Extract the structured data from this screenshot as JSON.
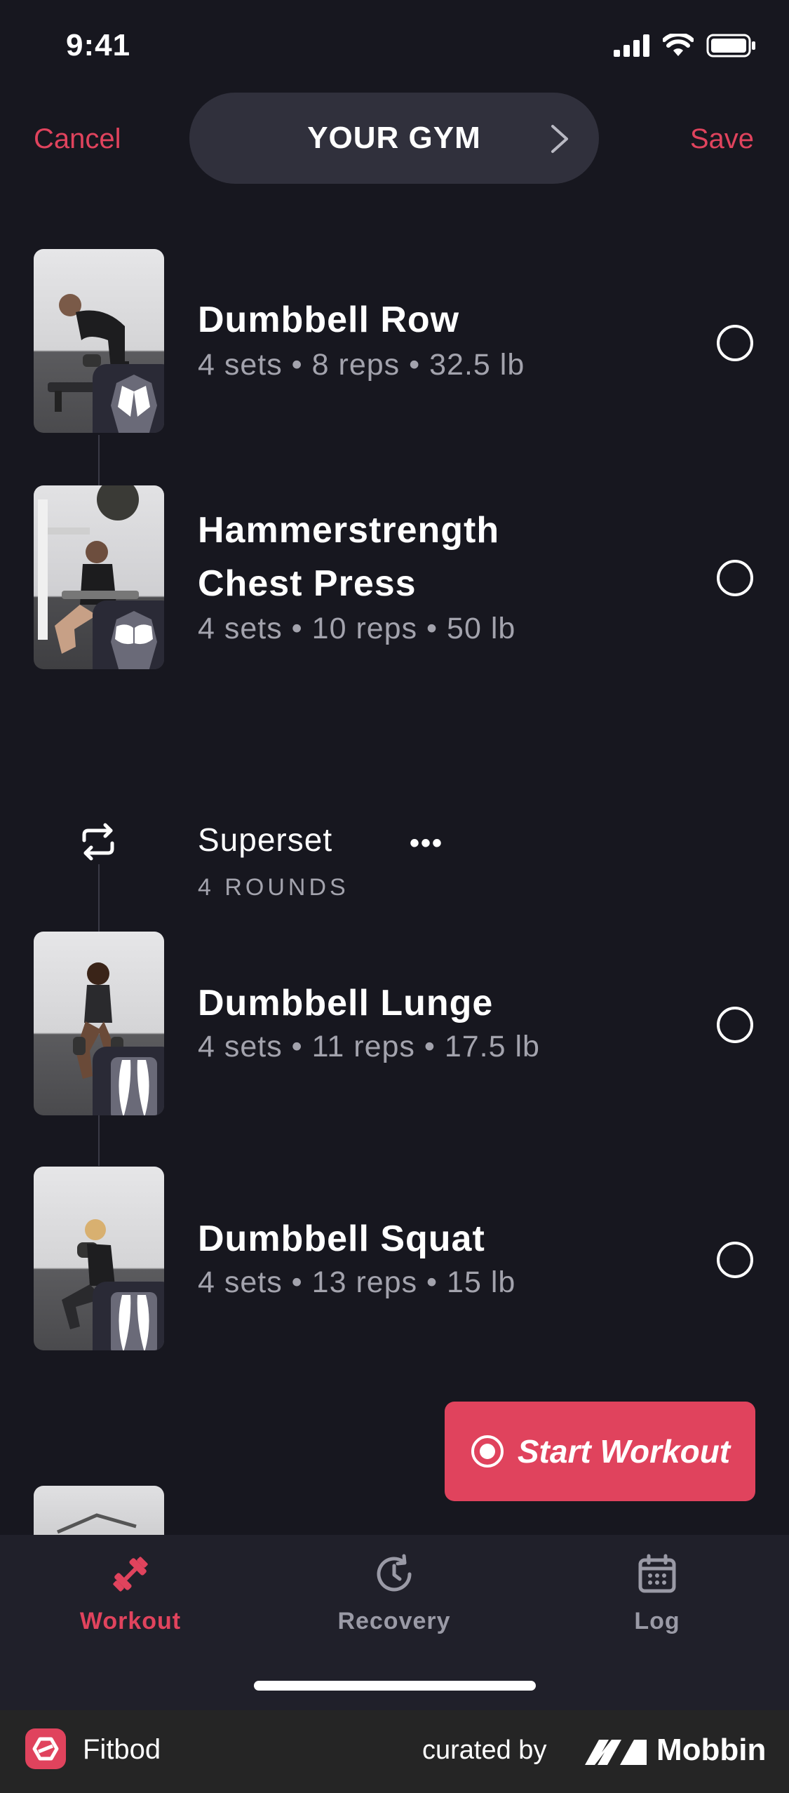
{
  "status_bar": {
    "time": "9:41"
  },
  "header": {
    "cancel": "Cancel",
    "title": "YOUR GYM",
    "save": "Save"
  },
  "exercises_top": [
    {
      "name": "Dumbbell Row",
      "detail": "4 sets • 8 reps • 32.5 lb"
    },
    {
      "name_line1": "Hammerstrength",
      "name_line2": "Chest Press",
      "detail": "4 sets • 10 reps • 50 lb"
    }
  ],
  "superset": {
    "title": "Superset",
    "rounds": "4 ROUNDS",
    "more": "•••"
  },
  "exercises_superset": [
    {
      "name": "Dumbbell Lunge",
      "detail": "4 sets • 11 reps • 17.5 lb"
    },
    {
      "name": "Dumbbell Squat",
      "detail": "4 sets • 13 reps • 15 lb"
    }
  ],
  "start_button": {
    "label": "Start Workout"
  },
  "tabs": [
    {
      "label": "Workout",
      "icon": "dumbbell-icon",
      "active": true
    },
    {
      "label": "Recovery",
      "icon": "recovery-clock-icon",
      "active": false
    },
    {
      "label": "Log",
      "icon": "calendar-icon",
      "active": false
    }
  ],
  "footer": {
    "app_name": "Fitbod",
    "curated_by": "curated by",
    "brand": "Mobbin"
  },
  "colors": {
    "accent": "#e0435d",
    "background": "#17171f",
    "secondary_text": "#a3a3ad",
    "tab_inactive": "#9a9aa6"
  }
}
